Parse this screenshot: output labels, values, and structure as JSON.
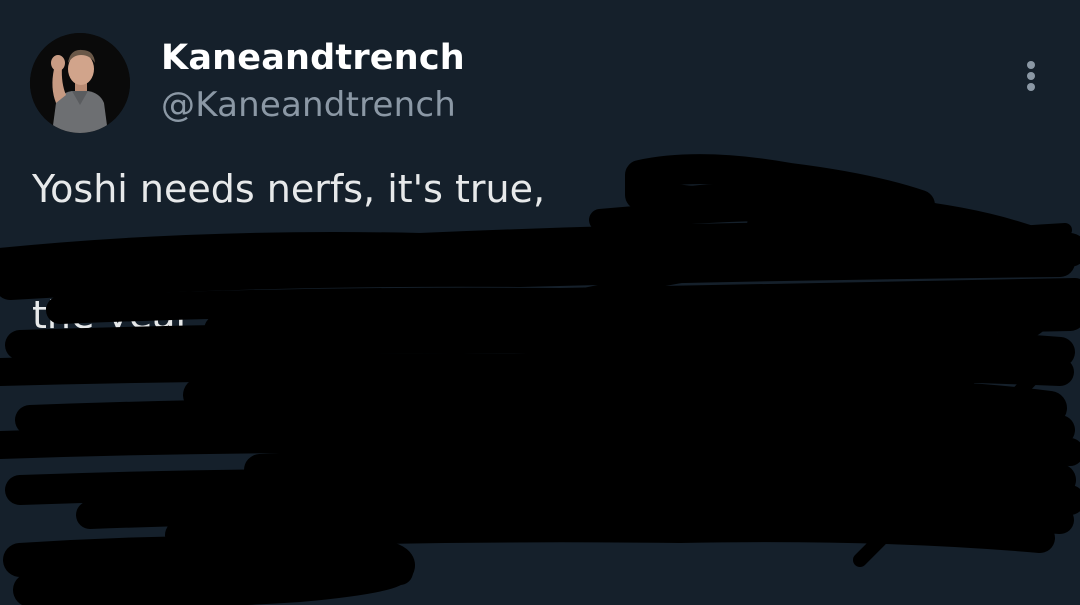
{
  "tweet": {
    "author": {
      "display_name": "Kaneandtrench",
      "handle": "@Kaneandtrench",
      "avatar_icon": "profile-photo"
    },
    "more_icon": "vertical-ellipsis-icon",
    "text_lines": [
      "Yoshi needs nerfs, it's true,",
      "",
      "the year",
      "",
      "",
      "",
      ""
    ],
    "redaction_color": "#000000"
  },
  "colors": {
    "background": "#15202b",
    "display_name": "#ffffff",
    "handle": "#8b98a5",
    "body_text": "#e7e9ea"
  }
}
